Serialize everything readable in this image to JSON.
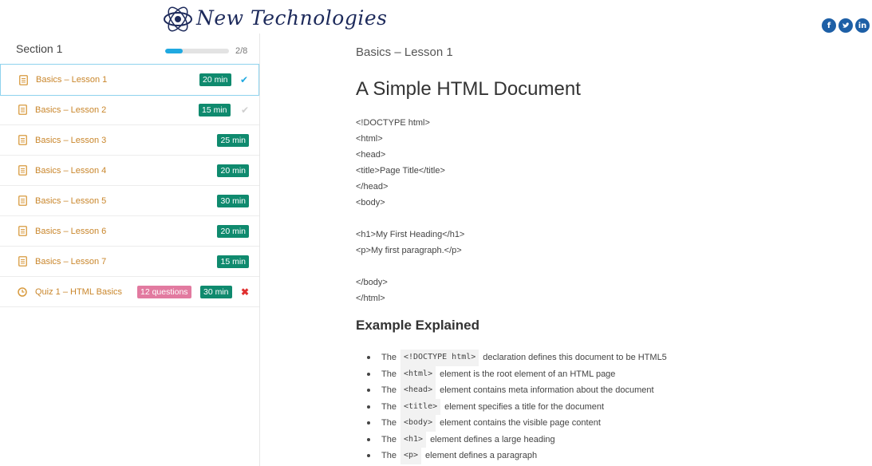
{
  "brand": {
    "name": "New Technologies"
  },
  "social": [
    {
      "name": "facebook-icon",
      "glyph": "f"
    },
    {
      "name": "twitter-icon",
      "glyph": "t"
    },
    {
      "name": "linkedin-icon",
      "glyph": "in"
    }
  ],
  "sidebar": {
    "section_title": "Section 1",
    "progress_count": "2/8",
    "progress_fraction": 0.28,
    "lessons": [
      {
        "label": "Basics – Lesson 1",
        "time": "20 min",
        "status": "done",
        "status_glyph": "✔"
      },
      {
        "label": "Basics – Lesson 2",
        "time": "15 min",
        "status": "pending",
        "status_glyph": "✔"
      },
      {
        "label": "Basics – Lesson 3",
        "time": "25 min",
        "status": "",
        "status_glyph": ""
      },
      {
        "label": "Basics – Lesson 4",
        "time": "20 min",
        "status": "",
        "status_glyph": ""
      },
      {
        "label": "Basics – Lesson 5",
        "time": "30 min",
        "status": "",
        "status_glyph": ""
      },
      {
        "label": "Basics – Lesson 6",
        "time": "20 min",
        "status": "",
        "status_glyph": ""
      },
      {
        "label": "Basics – Lesson 7",
        "time": "15 min",
        "status": "",
        "status_glyph": ""
      }
    ],
    "quiz": {
      "label": "Quiz 1 – HTML Basics",
      "questions": "12 questions",
      "time": "30 min",
      "status_glyph": "✖"
    }
  },
  "main": {
    "breadcrumb": "Basics – Lesson 1",
    "title": "A Simple HTML Document",
    "code_lines": [
      "<!DOCTYPE html>",
      "<html>",
      "<head>",
      "<title>Page Title</title>",
      "</head>",
      "<body>",
      "",
      "<h1>My First Heading</h1>",
      "<p>My first paragraph.</p>",
      "",
      "</body>",
      "</html>"
    ],
    "subtitle": "Example Explained",
    "explain": [
      {
        "pre": "The",
        "kw": "<!DOCTYPE html>",
        "post": "declaration defines this document to be HTML5"
      },
      {
        "pre": "The",
        "kw": "<html>",
        "post": "element is the root element of an HTML page"
      },
      {
        "pre": "The",
        "kw": "<head>",
        "post": "element contains meta information about the document"
      },
      {
        "pre": "The",
        "kw": "<title>",
        "post": "element specifies a title for the document"
      },
      {
        "pre": "The",
        "kw": "<body>",
        "post": "element contains the visible page content"
      },
      {
        "pre": "The",
        "kw": "<h1>",
        "post": "element defines a large heading"
      },
      {
        "pre": "The",
        "kw": "<p>",
        "post": "element defines a paragraph"
      }
    ]
  }
}
